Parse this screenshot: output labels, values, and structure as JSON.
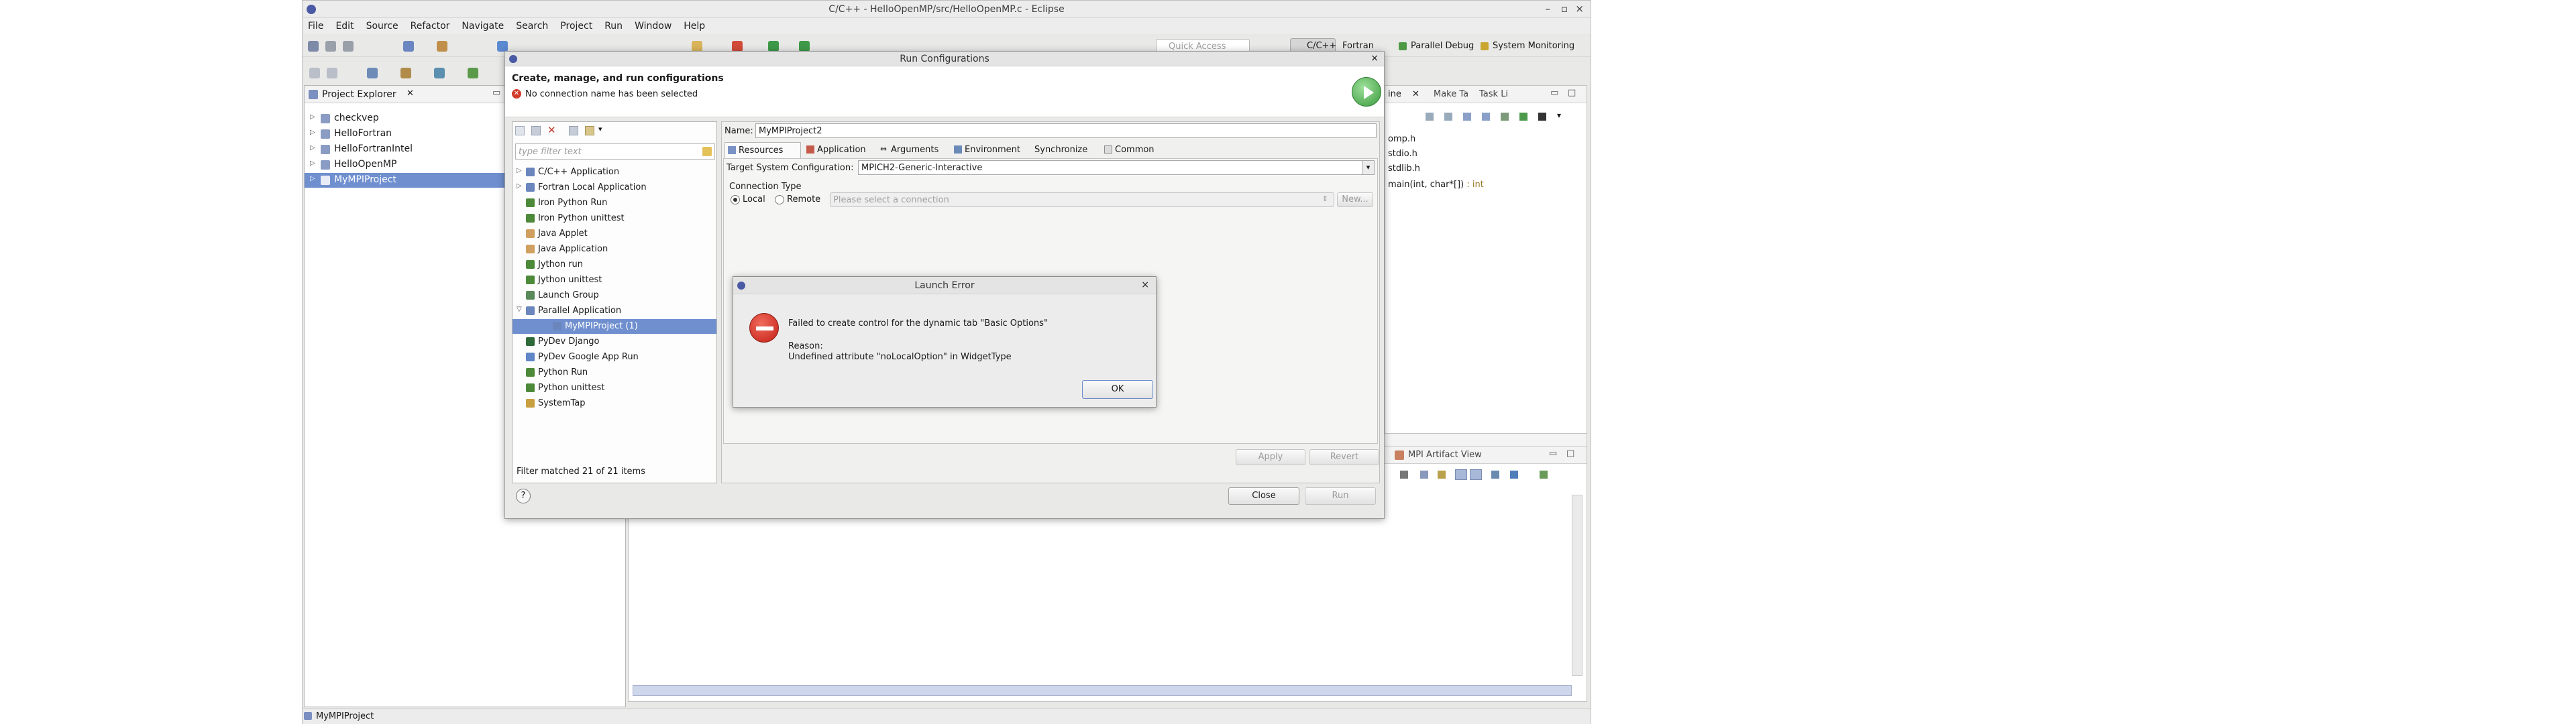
{
  "window": {
    "title": "C/C++ - HelloOpenMP/src/HelloOpenMP.c - Eclipse",
    "controls": [
      "–",
      "▫",
      "×"
    ]
  },
  "menu": [
    "File",
    "Edit",
    "Source",
    "Refactor",
    "Navigate",
    "Search",
    "Project",
    "Run",
    "Window",
    "Help"
  ],
  "toolbar": {
    "quick_access_placeholder": "Quick Access",
    "perspectives": [
      "C/C++",
      "Fortran",
      "Parallel Debug",
      "System Monitoring"
    ]
  },
  "project_explorer": {
    "tab_label": "Project Explorer",
    "projects": [
      {
        "name": "checkvep",
        "selected": false
      },
      {
        "name": "HelloFortran",
        "selected": false
      },
      {
        "name": "HelloFortranIntel",
        "selected": false
      },
      {
        "name": "HelloOpenMP",
        "selected": false
      },
      {
        "name": "MyMPIProject",
        "selected": true
      }
    ]
  },
  "outline": {
    "tabs": [
      "ine",
      "Make Ta",
      "Task Li"
    ],
    "items": [
      "omp.h",
      "stdio.h",
      "stdlib.h",
      "main(int, char*[]) : int"
    ]
  },
  "bottom_view": {
    "tab_label": "MPI Artifact View"
  },
  "status_bar": {
    "text": "MyMPIProject"
  },
  "run_configurations": {
    "title": "Run Configurations",
    "header_title": "Create, manage, and run configurations",
    "error_message": "No connection name has been selected",
    "filter_placeholder": "type filter text",
    "tree": [
      {
        "label": "C/C++ Application",
        "level": 0,
        "expand": "+",
        "icon": "c-app-icon"
      },
      {
        "label": "Fortran Local Application",
        "level": 0,
        "expand": "+",
        "icon": "fortran-app-icon"
      },
      {
        "label": "Iron Python Run",
        "level": 0,
        "expand": "",
        "icon": "python-icon"
      },
      {
        "label": "Iron Python unittest",
        "level": 0,
        "expand": "",
        "icon": "python-icon"
      },
      {
        "label": "Java Applet",
        "level": 0,
        "expand": "",
        "icon": "java-icon"
      },
      {
        "label": "Java Application",
        "level": 0,
        "expand": "",
        "icon": "java-icon"
      },
      {
        "label": "Jython run",
        "level": 0,
        "expand": "",
        "icon": "python-icon"
      },
      {
        "label": "Jython unittest",
        "level": 0,
        "expand": "",
        "icon": "python-icon"
      },
      {
        "label": "Launch Group",
        "level": 0,
        "expand": "",
        "icon": "launch-group-icon"
      },
      {
        "label": "Parallel Application",
        "level": 0,
        "expand": "−",
        "icon": "parallel-app-icon"
      },
      {
        "label": "MyMPIProject (1)",
        "level": 1,
        "expand": "",
        "icon": "parallel-app-icon",
        "selected": true
      },
      {
        "label": "PyDev Django",
        "level": 0,
        "expand": "",
        "icon": "django-icon"
      },
      {
        "label": "PyDev Google App Run",
        "level": 0,
        "expand": "",
        "icon": "google-app-icon"
      },
      {
        "label": "Python Run",
        "level": 0,
        "expand": "",
        "icon": "python-icon"
      },
      {
        "label": "Python unittest",
        "level": 0,
        "expand": "",
        "icon": "python-icon"
      },
      {
        "label": "SystemTap",
        "level": 0,
        "expand": "",
        "icon": "systemtap-icon"
      }
    ],
    "filter_status": "Filter matched 21 of 21 items",
    "name_label": "Name:",
    "name_value": "MyMPIProject2",
    "tabs": [
      "Resources",
      "Application",
      "Arguments",
      "Environment",
      "Synchronize",
      "Common"
    ],
    "target_label": "Target System Configuration:",
    "target_value": "MPICH2-Generic-Interactive",
    "connection_type_label": "Connection Type",
    "radio_local": "Local",
    "radio_remote": "Remote",
    "connection_placeholder": "Please select a connection",
    "new_button": "New...",
    "apply_button": "Apply",
    "revert_button": "Revert",
    "close_button": "Close",
    "run_button": "Run",
    "help_icon": "?"
  },
  "launch_error": {
    "title": "Launch Error",
    "message": "Failed to create control for the dynamic tab \"Basic Options\"",
    "reason_label": "Reason:",
    "reason_text": "Undefined attribute \"noLocalOption\" in WidgetType",
    "ok_button": "OK"
  }
}
